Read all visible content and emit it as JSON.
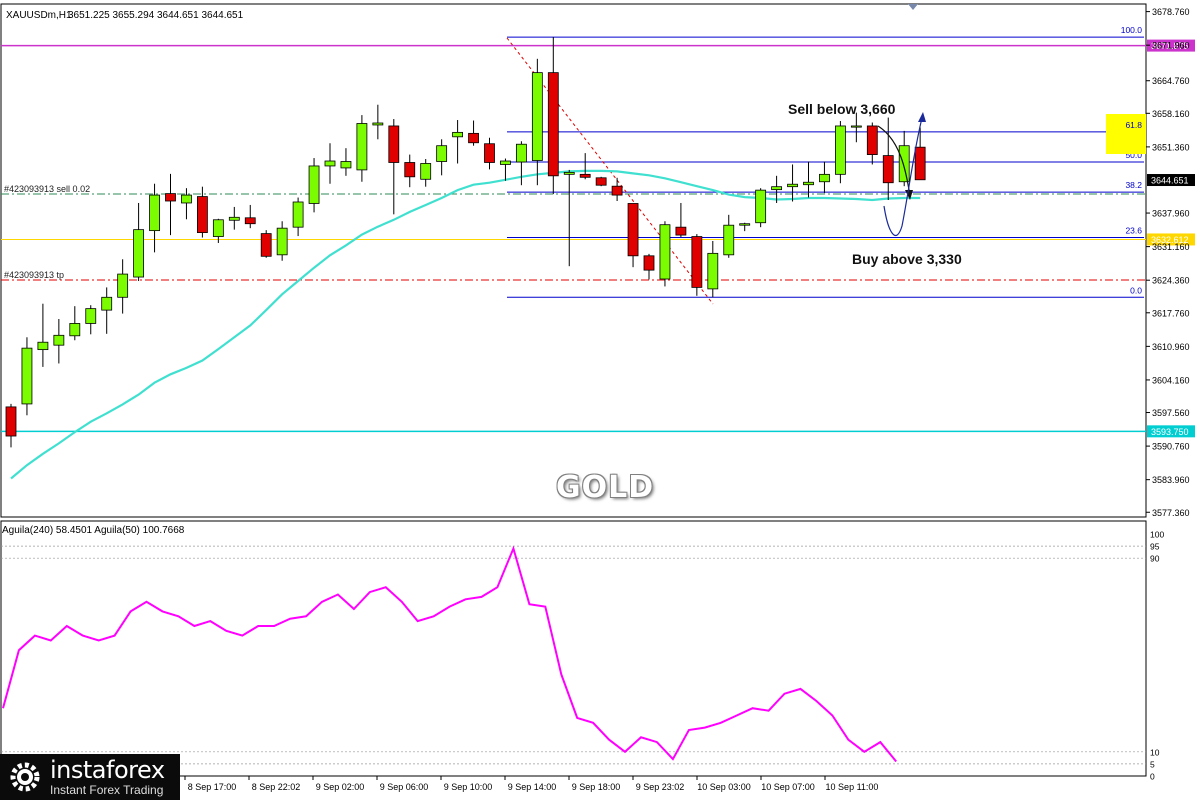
{
  "header": {
    "symbol": "XAUUSDm,H1",
    "ohlc": "3651.225 3655.294 3644.651 3644.651"
  },
  "indicator_header": "Aguila(240) 58.4501  Aguila(50) 100.7668",
  "watermark": "GOLD",
  "brand": {
    "name": "instaforex",
    "tagline": "Instant Forex Trading"
  },
  "annotations": {
    "sell": "Sell below 3,660",
    "buy": "Buy above 3,330",
    "sell_order": "#423093913 sell 0.02",
    "tp": "#423093913 tp"
  },
  "colors": {
    "bull": "#7CFC00",
    "bear": "#E00000",
    "ma": "#40E0D0",
    "osc": "#FF00FF",
    "fib": "#0000CD",
    "magenta_level": "#CC33CC",
    "yellow_level": "#FFD700",
    "cyan_level": "#00CED1",
    "tp_line": "#E00000",
    "sell_line": "#2E8B57"
  },
  "chart_data": [
    {
      "type": "candlestick",
      "symbol": "XAUUSDm",
      "timeframe": "H1",
      "y_ticks": [
        "3678.760",
        "3671.960",
        "3664.760",
        "3658.160",
        "3651.360",
        "3644.651",
        "3637.960",
        "3631.160",
        "3624.360",
        "3617.760",
        "3610.960",
        "3604.160",
        "3597.560",
        "3590.760",
        "3583.960",
        "3577.360"
      ],
      "ylim": [
        3576.4,
        3680.3
      ],
      "x_labels": [
        "8 Sep 17:00",
        "8 Sep 22:02",
        "9 Sep 02:00",
        "9 Sep 06:00",
        "9 Sep 10:00",
        "9 Sep 14:00",
        "9 Sep 18:00",
        "9 Sep 23:02",
        "10 Sep 03:00",
        "10 Sep 07:00",
        "10 Sep 11:00"
      ],
      "levels": [
        {
          "value": 3671.875,
          "label": "3671.875",
          "color": "magenta_level"
        },
        {
          "value": 3632.612,
          "label": "3632.612",
          "color": "yellow_level"
        },
        {
          "value": 3593.75,
          "label": "3593.750",
          "color": "cyan_level"
        },
        {
          "value": 3644.651,
          "label": "3644.651",
          "color": "current"
        }
      ],
      "fibonacci": [
        {
          "label": "100.0",
          "value": 3673.6
        },
        {
          "label": "61.8",
          "value": 3654.4
        },
        {
          "label": "50.0",
          "value": 3648.3
        },
        {
          "label": "38.2",
          "value": 3642.2
        },
        {
          "label": "23.6",
          "value": 3633.0
        },
        {
          "label": "0.0",
          "value": 3620.9
        }
      ],
      "candles": [
        {
          "o": 3598.7,
          "h": 3599.3,
          "l": 3590.5,
          "c": 3592.8
        },
        {
          "o": 3599.3,
          "h": 3612.8,
          "l": 3597.0,
          "c": 3610.6
        },
        {
          "o": 3610.3,
          "h": 3619.6,
          "l": 3606.8,
          "c": 3611.8
        },
        {
          "o": 3611.2,
          "h": 3616.5,
          "l": 3607.5,
          "c": 3613.2
        },
        {
          "o": 3613.1,
          "h": 3619.1,
          "l": 3612.2,
          "c": 3615.6
        },
        {
          "o": 3615.6,
          "h": 3619.3,
          "l": 3613.4,
          "c": 3618.6
        },
        {
          "o": 3618.3,
          "h": 3622.9,
          "l": 3613.5,
          "c": 3620.9
        },
        {
          "o": 3620.9,
          "h": 3628.6,
          "l": 3617.6,
          "c": 3625.6
        },
        {
          "o": 3625.0,
          "h": 3640.0,
          "l": 3624.2,
          "c": 3634.6
        },
        {
          "o": 3634.4,
          "h": 3643.9,
          "l": 3630.0,
          "c": 3641.6
        },
        {
          "o": 3641.9,
          "h": 3645.9,
          "l": 3633.5,
          "c": 3640.4
        },
        {
          "o": 3640.0,
          "h": 3643.0,
          "l": 3636.7,
          "c": 3641.6
        },
        {
          "o": 3641.3,
          "h": 3643.3,
          "l": 3633.0,
          "c": 3634.0
        },
        {
          "o": 3633.2,
          "h": 3636.8,
          "l": 3631.9,
          "c": 3636.6
        },
        {
          "o": 3636.5,
          "h": 3639.2,
          "l": 3634.6,
          "c": 3637.1
        },
        {
          "o": 3637.0,
          "h": 3639.6,
          "l": 3634.9,
          "c": 3635.8
        },
        {
          "o": 3633.8,
          "h": 3634.5,
          "l": 3628.9,
          "c": 3629.2
        },
        {
          "o": 3629.5,
          "h": 3636.3,
          "l": 3628.3,
          "c": 3634.9
        },
        {
          "o": 3635.1,
          "h": 3641.1,
          "l": 3633.3,
          "c": 3640.2
        },
        {
          "o": 3639.9,
          "h": 3649.1,
          "l": 3638.1,
          "c": 3647.5
        },
        {
          "o": 3647.5,
          "h": 3652.1,
          "l": 3643.9,
          "c": 3648.5
        },
        {
          "o": 3647.1,
          "h": 3651.1,
          "l": 3645.5,
          "c": 3648.4
        },
        {
          "o": 3646.7,
          "h": 3657.8,
          "l": 3644.3,
          "c": 3656.1
        },
        {
          "o": 3655.8,
          "h": 3659.9,
          "l": 3652.9,
          "c": 3656.2
        },
        {
          "o": 3655.6,
          "h": 3657.0,
          "l": 3637.7,
          "c": 3648.2
        },
        {
          "o": 3648.2,
          "h": 3649.8,
          "l": 3643.2,
          "c": 3645.3
        },
        {
          "o": 3644.8,
          "h": 3648.9,
          "l": 3643.3,
          "c": 3648.0
        },
        {
          "o": 3648.4,
          "h": 3652.9,
          "l": 3645.6,
          "c": 3651.6
        },
        {
          "o": 3653.4,
          "h": 3656.8,
          "l": 3648.0,
          "c": 3654.3
        },
        {
          "o": 3654.1,
          "h": 3656.7,
          "l": 3651.6,
          "c": 3652.2
        },
        {
          "o": 3652.0,
          "h": 3653.2,
          "l": 3646.8,
          "c": 3648.2
        },
        {
          "o": 3647.8,
          "h": 3649.0,
          "l": 3644.5,
          "c": 3648.5
        },
        {
          "o": 3648.3,
          "h": 3652.5,
          "l": 3643.6,
          "c": 3651.9
        },
        {
          "o": 3648.6,
          "h": 3669.2,
          "l": 3643.6,
          "c": 3666.4
        },
        {
          "o": 3666.4,
          "h": 3673.6,
          "l": 3641.8,
          "c": 3645.5
        },
        {
          "o": 3645.8,
          "h": 3646.7,
          "l": 3627.2,
          "c": 3646.2
        },
        {
          "o": 3645.8,
          "h": 3650.1,
          "l": 3644.8,
          "c": 3645.2
        },
        {
          "o": 3645.1,
          "h": 3645.3,
          "l": 3643.4,
          "c": 3643.6
        },
        {
          "o": 3643.4,
          "h": 3645.1,
          "l": 3640.4,
          "c": 3641.6
        },
        {
          "o": 3639.9,
          "h": 3639.9,
          "l": 3627.0,
          "c": 3629.3
        },
        {
          "o": 3629.3,
          "h": 3629.7,
          "l": 3624.5,
          "c": 3626.4
        },
        {
          "o": 3624.6,
          "h": 3636.3,
          "l": 3623.1,
          "c": 3635.6
        },
        {
          "o": 3635.1,
          "h": 3640.0,
          "l": 3633.1,
          "c": 3633.5
        },
        {
          "o": 3633.2,
          "h": 3633.7,
          "l": 3621.2,
          "c": 3622.9
        },
        {
          "o": 3622.6,
          "h": 3632.3,
          "l": 3620.9,
          "c": 3629.8
        },
        {
          "o": 3629.5,
          "h": 3637.6,
          "l": 3628.9,
          "c": 3635.5
        },
        {
          "o": 3635.5,
          "h": 3636.0,
          "l": 3634.3,
          "c": 3635.8
        },
        {
          "o": 3636.0,
          "h": 3643.0,
          "l": 3635.1,
          "c": 3642.6
        },
        {
          "o": 3642.7,
          "h": 3645.5,
          "l": 3640.0,
          "c": 3643.3
        },
        {
          "o": 3643.3,
          "h": 3647.8,
          "l": 3640.3,
          "c": 3643.8
        },
        {
          "o": 3643.7,
          "h": 3648.4,
          "l": 3641.1,
          "c": 3644.2
        },
        {
          "o": 3644.3,
          "h": 3648.4,
          "l": 3642.0,
          "c": 3645.8
        },
        {
          "o": 3645.8,
          "h": 3656.6,
          "l": 3644.0,
          "c": 3655.6
        },
        {
          "o": 3655.5,
          "h": 3658.3,
          "l": 3652.3,
          "c": 3655.6
        },
        {
          "o": 3655.6,
          "h": 3656.3,
          "l": 3647.8,
          "c": 3649.8
        },
        {
          "o": 3649.6,
          "h": 3657.3,
          "l": 3640.6,
          "c": 3644.1
        },
        {
          "o": 3644.3,
          "h": 3654.6,
          "l": 3643.4,
          "c": 3651.6
        },
        {
          "o": 3651.3,
          "h": 3655.3,
          "l": 3644.7,
          "c": 3644.7
        }
      ],
      "ma": [
        3584.2,
        3586.9,
        3589.2,
        3591.3,
        3593.6,
        3595.7,
        3597.4,
        3599.2,
        3601.2,
        3603.6,
        3605.3,
        3606.6,
        3608.1,
        3610.4,
        3612.8,
        3615.2,
        3618.3,
        3621.5,
        3624.2,
        3626.9,
        3629.4,
        3631.4,
        3633.6,
        3635.2,
        3636.6,
        3638.2,
        3639.6,
        3641.0,
        3642.6,
        3643.7,
        3644.1,
        3644.7,
        3645.3,
        3645.8,
        3646.1,
        3646.4,
        3646.5,
        3646.5,
        3646.4,
        3646.0,
        3645.6,
        3645.0,
        3644.2,
        3643.4,
        3642.6,
        3641.7,
        3641.2,
        3641.0,
        3640.7,
        3640.8,
        3641.0,
        3641.0,
        3640.9,
        3640.8,
        3640.6,
        3640.9,
        3641.0,
        3641.0
      ],
      "oscillator": {
        "scale": [
          100,
          95,
          90,
          10,
          5,
          0
        ],
        "aguila240": [
          28,
          52,
          58,
          56,
          62,
          58,
          56,
          58,
          68,
          72,
          68,
          66,
          62,
          64,
          60,
          58,
          62,
          62,
          65,
          66,
          72,
          75,
          69,
          76,
          78,
          72,
          64,
          66,
          70,
          73,
          74,
          78,
          94,
          71,
          70,
          42,
          24,
          22,
          15,
          10,
          16,
          14,
          7,
          19,
          20,
          22,
          25,
          28,
          27,
          34,
          36,
          31,
          25,
          15,
          10,
          14,
          6
        ]
      }
    }
  ]
}
